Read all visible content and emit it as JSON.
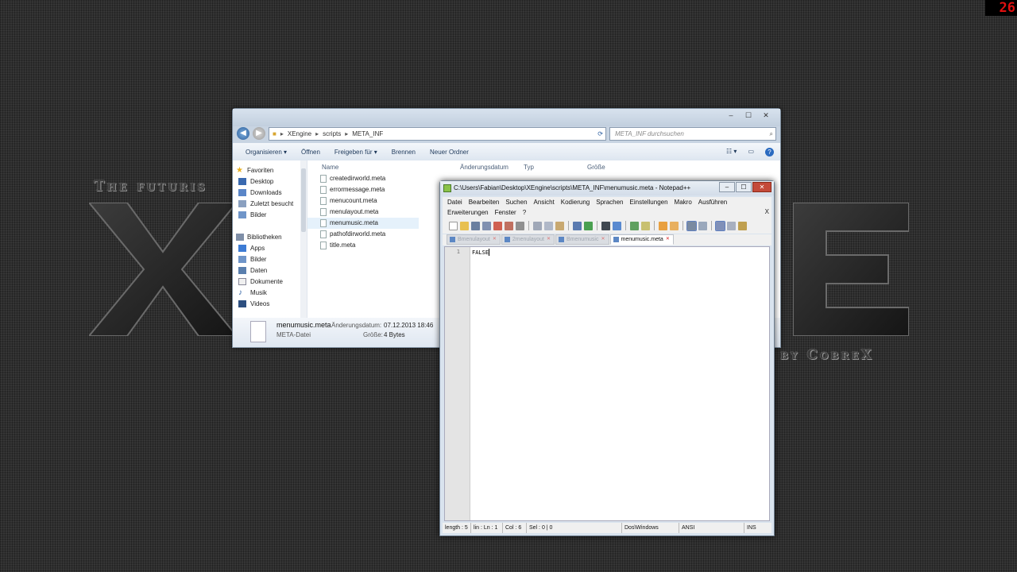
{
  "wallpaper": {
    "tagline_left": "The futuris",
    "tagline_right": "by CobreX",
    "counter": "26"
  },
  "explorer": {
    "title_buttons": [
      "–",
      "☐",
      "✕"
    ],
    "address": {
      "crumbs": [
        "XEngine",
        "scripts",
        "META_INF"
      ]
    },
    "search_placeholder": "META_INF durchsuchen",
    "toolbar": {
      "organize": "Organisieren ▾",
      "open": "Öffnen",
      "share": "Freigeben für ▾",
      "burn": "Brennen",
      "new_folder": "Neuer Ordner"
    },
    "nav": {
      "favorites": "Favoriten",
      "desktop": "Desktop",
      "downloads": "Downloads",
      "recent": "Zuletzt besucht",
      "pictures": "Bilder",
      "libraries": "Bibliotheken",
      "apps": "Apps",
      "lib_pictures": "Bilder",
      "data": "Daten",
      "documents": "Dokumente",
      "music": "Musik",
      "videos": "Videos"
    },
    "columns": {
      "name": "Name",
      "date": "Änderungsdatum",
      "type": "Typ",
      "size": "Größe"
    },
    "files": [
      "createdirworld.meta",
      "errormessage.meta",
      "menucount.meta",
      "menulayout.meta",
      "menumusic.meta",
      "pathofdirworld.meta",
      "title.meta"
    ],
    "details": {
      "filename": "menumusic.meta",
      "filetype": "META-Datei",
      "date_label": "Änderungsdatum:",
      "date_value": "07.12.2013 18:46",
      "size_label": "Größe:",
      "size_value": "4 Bytes"
    }
  },
  "notepad": {
    "title": "C:\\Users\\Fabian\\Desktop\\XEngine\\scripts\\META_INF\\menumusic.meta - Notepad++",
    "menu_row1": [
      "Datei",
      "Bearbeiten",
      "Suchen",
      "Ansicht",
      "Kodierung",
      "Sprachen",
      "Einstellungen",
      "Makro",
      "Ausführen"
    ],
    "menu_row2": [
      "Erweiterungen",
      "Fenster",
      "?"
    ],
    "menu_close": "X",
    "tabs": [
      "Bmenulayout",
      "2menulayout",
      "Bmenumusic",
      "menumusic.meta"
    ],
    "line_number": "1",
    "content": "FALSE",
    "status": {
      "length": "length : 5",
      "pos": "lin : Ln : 1",
      "col": "Col : 6",
      "sel": "Sel : 0 | 0",
      "eol": "Dos\\Windows",
      "encoding": "ANSI",
      "mode": "INS"
    }
  }
}
